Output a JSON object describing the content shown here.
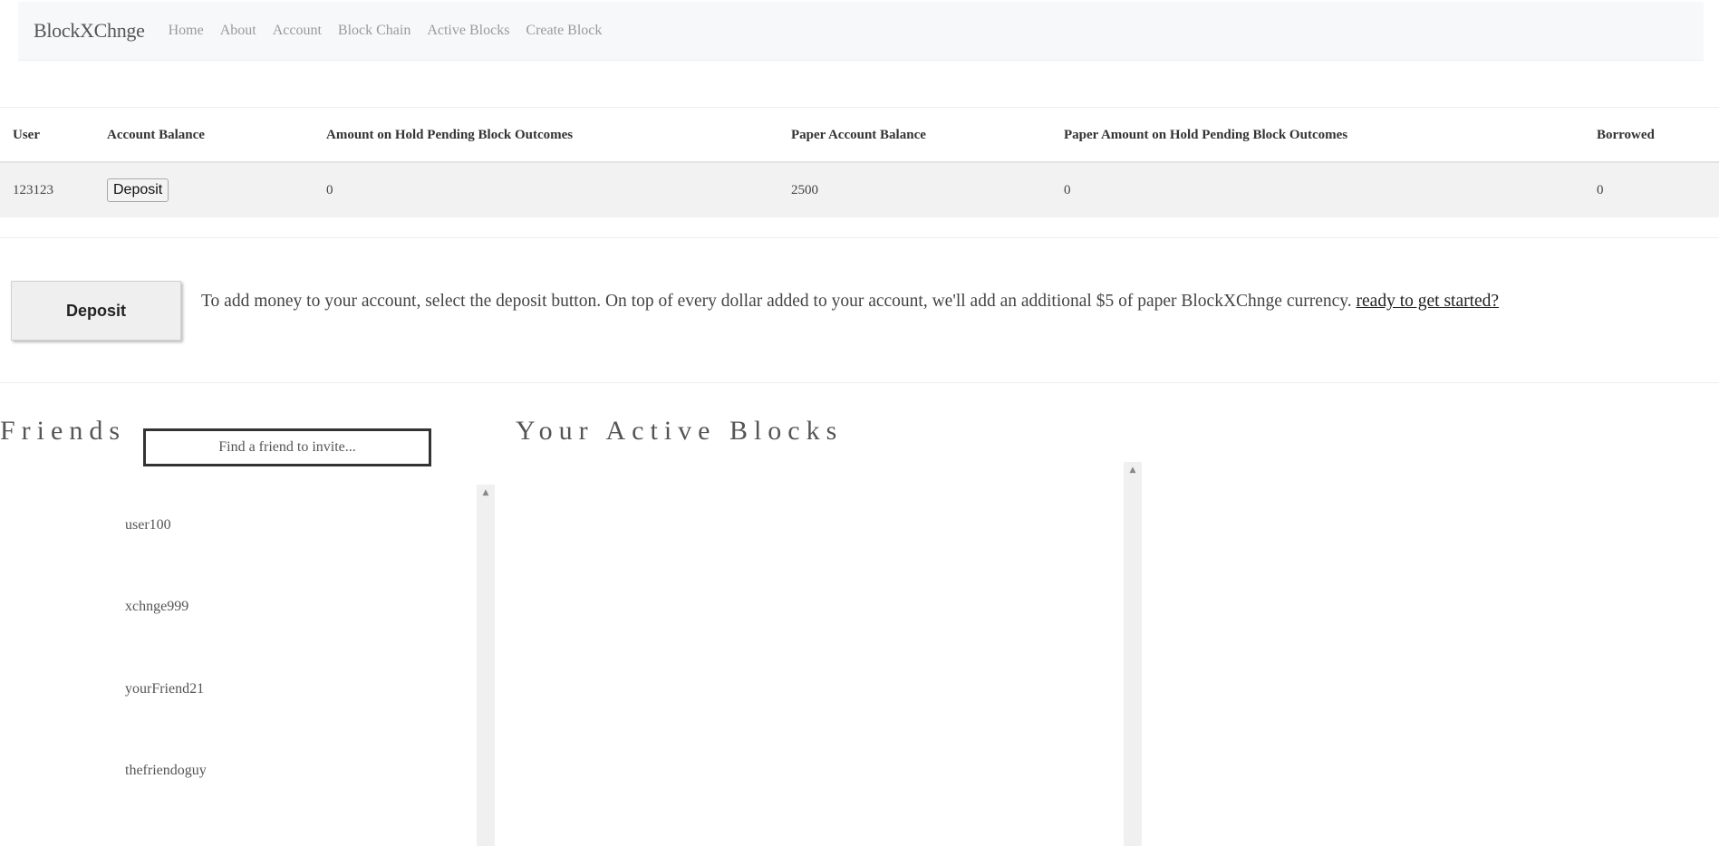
{
  "navbar": {
    "brand": "BlockXChnge",
    "links": [
      "Home",
      "About",
      "Account",
      "Block Chain",
      "Active Blocks",
      "Create Block"
    ]
  },
  "account_table": {
    "headers": [
      "User",
      "Account Balance",
      "Amount on Hold Pending Block Outcomes",
      "Paper Account Balance",
      "Paper Amount on Hold Pending Block Outcomes",
      "Borrowed"
    ],
    "row": {
      "user": "123123",
      "deposit_label": "Deposit",
      "amount_on_hold": "0",
      "paper_balance": "2500",
      "paper_on_hold": "0",
      "borrowed": "0"
    }
  },
  "deposit_section": {
    "button_label": "Deposit",
    "text": "To add money to your account, select the deposit button. On top of every dollar added to your account, we'll add an additional $5 of paper BlockXChnge currency.",
    "link_text": "ready to get started?"
  },
  "friends": {
    "title": "Friends",
    "search_placeholder": "Find a friend to invite...",
    "items": [
      "user100",
      "xchnge999",
      "yourFriend21",
      "thefriendoguy"
    ]
  },
  "active_blocks": {
    "title": "Your Active Blocks"
  }
}
